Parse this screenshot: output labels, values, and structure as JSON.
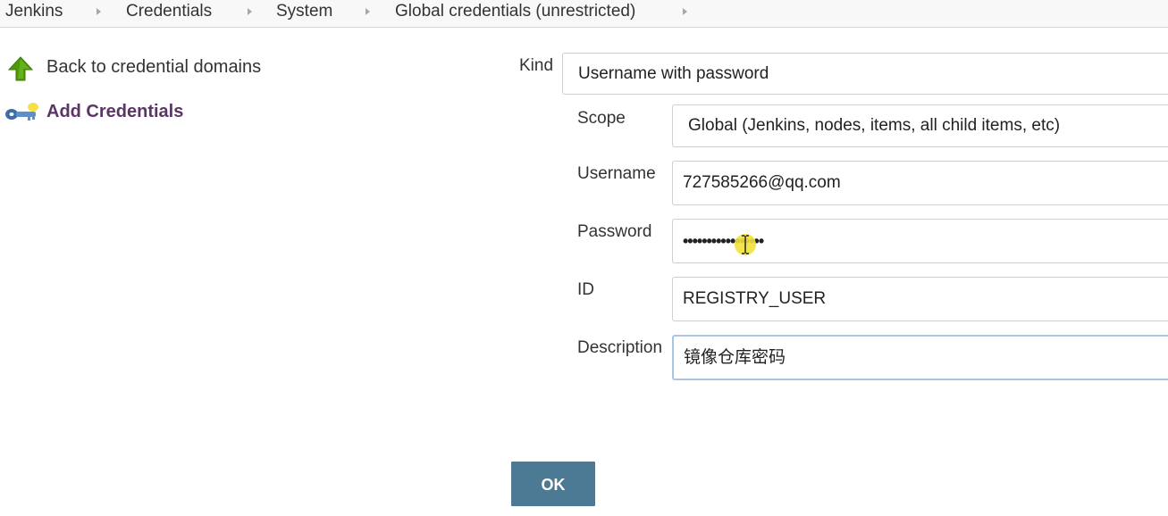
{
  "breadcrumb": {
    "items": [
      "Jenkins",
      "Credentials",
      "System",
      "Global credentials (unrestricted)"
    ]
  },
  "sidebar": {
    "back_label": "Back to credential domains",
    "add_label": "Add Credentials"
  },
  "form": {
    "kind": {
      "label": "Kind",
      "value": "Username with password"
    },
    "scope": {
      "label": "Scope",
      "value": "Global (Jenkins, nodes, items, all child items, etc)"
    },
    "username": {
      "label": "Username",
      "value": "727585266@qq.com"
    },
    "password": {
      "label": "Password",
      "value": "•••••••••••••••••"
    },
    "id": {
      "label": "ID",
      "value": "REGISTRY_USER"
    },
    "description": {
      "label": "Description",
      "value": "镜像仓库密码"
    },
    "ok_label": "OK"
  },
  "colors": {
    "ok_button": "#4c7a94",
    "add_link": "#5c3566",
    "cursor_highlight": "#f2e13a"
  }
}
